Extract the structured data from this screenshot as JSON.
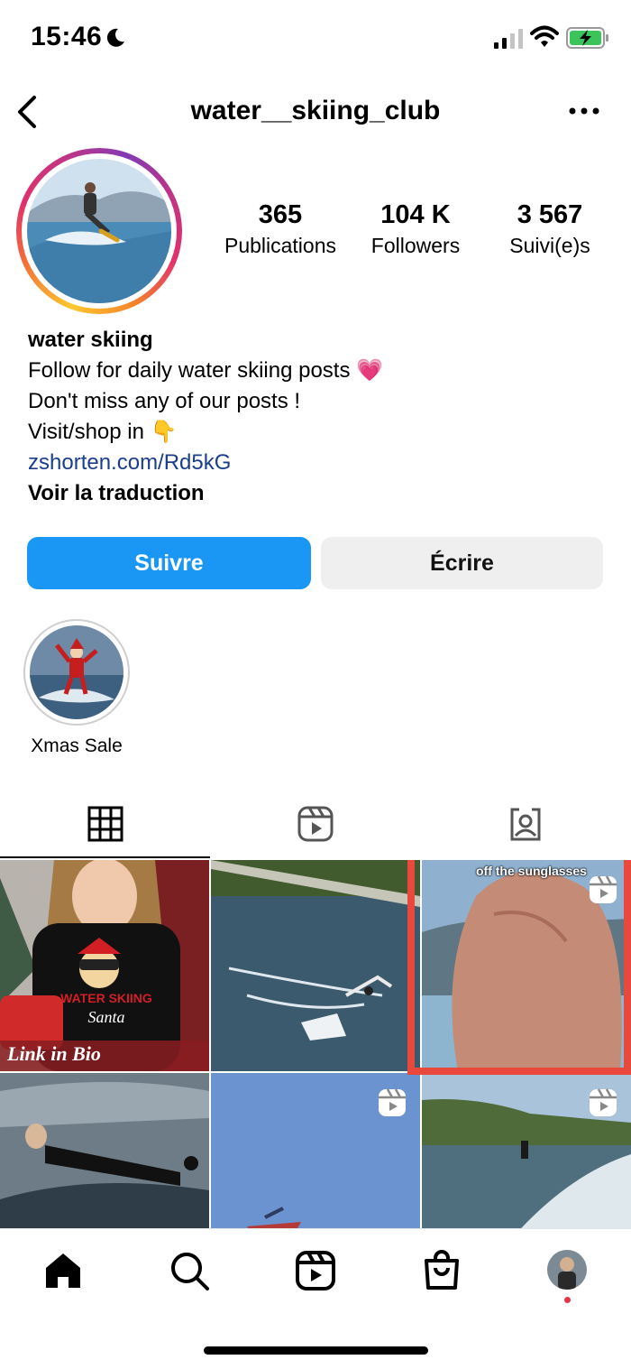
{
  "status_bar": {
    "time": "15:46"
  },
  "header": {
    "username": "water__skiing_club"
  },
  "stats": [
    {
      "value": "365",
      "label": "Publications"
    },
    {
      "value": "104 K",
      "label": "Followers"
    },
    {
      "value": "3 567",
      "label": "Suivi(e)s"
    }
  ],
  "bio": {
    "name": "water skiing",
    "line1": "Follow for daily water skiing posts 💗",
    "line2": "Don't miss any of our posts !",
    "line3": "Visit/shop in 👇",
    "link": "zshorten.com/Rd5kG",
    "translate": "Voir la traduction"
  },
  "buttons": {
    "follow": "Suivre",
    "message": "Écrire"
  },
  "highlights": [
    {
      "label": "Xmas Sale"
    }
  ],
  "grid": {
    "post1_text_line1": "WATER SKIING",
    "post1_text_line2": "Santa",
    "post1_text_line3": "Link in Bio",
    "post3_caption": "off the sunglasses"
  },
  "colors": {
    "accent": "#1a97f5",
    "highlight_frame": "#e8493c",
    "link": "#1a3e8c"
  }
}
